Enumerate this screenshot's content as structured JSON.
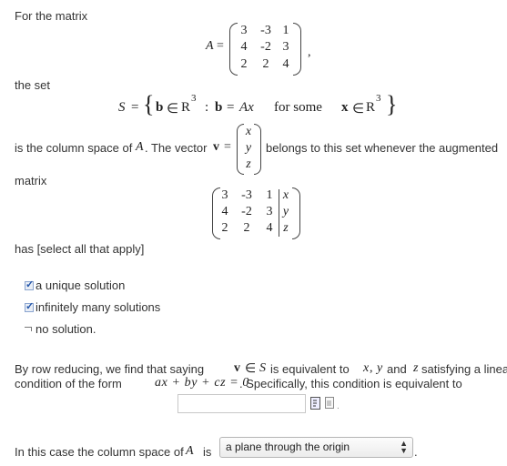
{
  "intro": "For the matrix",
  "matrix_A": {
    "name": "A",
    "rows": [
      [
        "3",
        "-3",
        "1"
      ],
      [
        "4",
        "-2",
        "3"
      ],
      [
        "2",
        "2",
        "4"
      ]
    ],
    "trailing": ","
  },
  "the_set_label": "the set",
  "set_def": {
    "s": "S",
    "eq": "=",
    "b": "b",
    "in": "∈",
    "r": "R",
    "exp": "3",
    "colon": ":",
    "ax": "Ax",
    "for_some": "for some",
    "x": "x"
  },
  "column_space": {
    "prefix": "is the column space of",
    "a": "A",
    "vector_text": ". The vector",
    "v": "v",
    "eq": "=",
    "vec": [
      "x",
      "y",
      "z"
    ],
    "suffix": "belongs to this set whenever the augmented"
  },
  "matrix_label": "matrix",
  "augmented": {
    "rows": [
      [
        "3",
        "-3",
        "1",
        "x"
      ],
      [
        "4",
        "-2",
        "3",
        "y"
      ],
      [
        "2",
        "2",
        "4",
        "z"
      ]
    ]
  },
  "has_select": "has [select all that apply]",
  "options": [
    {
      "label": "a unique solution",
      "checked": true
    },
    {
      "label": "infinitely many solutions",
      "checked": true
    },
    {
      "label": "no solution.",
      "checked": false
    }
  ],
  "row_reduce": {
    "p1": "By row reducing, we find that saying",
    "v": "v",
    "in": "∈",
    "s": "S",
    "p2": "is equivalent to",
    "x": "x",
    "comma": ",",
    "y": "y",
    "and": "and",
    "z": "z",
    "p3": "satisfying a linear",
    "line2a": "condition of the form",
    "formula": "ax + by + cz = 0",
    "line2b": ". Specifically, this condition is equivalent to"
  },
  "answer_input": {
    "value": ""
  },
  "final": {
    "prefix": "In this case the column space of",
    "a": "A",
    "is": "is",
    "selected": "a plane through the origin"
  }
}
